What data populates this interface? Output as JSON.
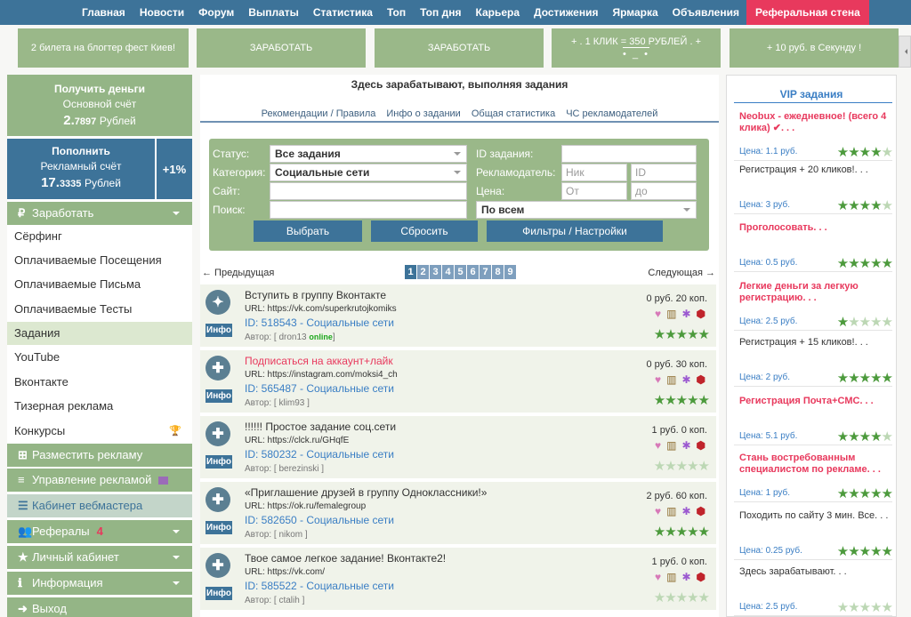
{
  "topnav": {
    "items": [
      "Главная",
      "Новости",
      "Форум",
      "Выплаты",
      "Статистика",
      "Топ",
      "Топ дня",
      "Карьера",
      "Достижения",
      "Ярмарка",
      "Объявления"
    ],
    "highlight": "Реферальная стена"
  },
  "banners": [
    {
      "line1": "2 билета на блогтер фест Киев!",
      "line2": ""
    },
    {
      "line1": "ЗАРАБОТАТЬ",
      "line2": ""
    },
    {
      "line1": "ЗАРАБОТАТЬ",
      "line2": ""
    },
    {
      "line1": "+ . 1 КЛИК = 350 РУБЛЕЙ . +",
      "line2": "• _ •"
    },
    {
      "line1": "+ 10 руб. в Секунду !",
      "line2": ""
    }
  ],
  "balance_main": {
    "title": "Получить деньги",
    "subtitle": "Основной счёт",
    "amount_int": "2.",
    "amount_frac": "7897",
    "currency": "Рублей"
  },
  "balance_ads": {
    "title": "Пополнить",
    "subtitle": "Рекламный счёт",
    "amount_int": "17.",
    "amount_frac": "3335",
    "currency": "Рублей",
    "bonus": "+1%"
  },
  "menu": {
    "earn": "Заработать",
    "earn_items": [
      "Сёрфинг",
      "Оплачиваемые Посещения",
      "Оплачиваемые Письма",
      "Оплачиваемые Тесты",
      "Задания",
      "YouTube",
      "Вконтакте",
      "Тизерная реклама",
      "Конкурсы"
    ],
    "place_ad": "Разместить рекламу",
    "manage_ads": "Управление рекламой",
    "webmaster": "Кабинет вебмастера",
    "referrals": "Рефералы",
    "referrals_count": "4",
    "cabinet": "Личный кабинет",
    "info": "Информация",
    "exit": "Выход"
  },
  "main": {
    "title": "Здесь зарабатывают, выполняя задания",
    "tabs": [
      "Рекомендации / Правила",
      "Инфо о задании",
      "Общая статистика",
      "ЧС рекламодателей"
    ]
  },
  "filter": {
    "status_label": "Статус:",
    "status_value": "Все задания",
    "category_label": "Категория:",
    "category_value": "Социальные сети",
    "site_label": "Сайт:",
    "search_label": "Поиск:",
    "id_label": "ID задания:",
    "advertiser_label": "Рекламодатель:",
    "advertiser_nick_ph": "Ник",
    "advertiser_id_ph": "ID",
    "price_label": "Цена:",
    "price_from_ph": "От",
    "price_to_ph": "до",
    "scope_value": "По всем",
    "btn_select": "Выбрать",
    "btn_reset": "Сбросить",
    "btn_filters": "Фильтры / Настройки"
  },
  "pager": {
    "prev": "← Предыдущая",
    "next": "Следующая →",
    "pages": [
      "1",
      "2",
      "3",
      "4",
      "5",
      "6",
      "7",
      "8",
      "9"
    ],
    "current": "1"
  },
  "tasks": [
    {
      "title": "Вступить в группу Вконтакте",
      "url": "URL: https://vk.com/superkrutojkomiks",
      "id": "ID: 518543 - Социальные сети",
      "author": "Автор: [ dron13",
      "online": "online",
      "author_end": "]",
      "price": "0 руб. 20 коп.",
      "stars": 5,
      "red": false,
      "icon": "✦"
    },
    {
      "title": "Подписаться на аккаунт+лайк",
      "url": "URL: https://instagram.com/moksi4_ch",
      "id": "ID: 565487 - Социальные сети",
      "author": "Автор: [ klim93 ]",
      "online": "",
      "author_end": "",
      "price": "0 руб. 30 коп.",
      "stars": 5,
      "red": true,
      "icon": "✚"
    },
    {
      "title": "!!!!!! Простое задание соц.сети",
      "url": "URL: https://clck.ru/GHqfE",
      "id": "ID: 580232 - Социальные сети",
      "author": "Автор: [ berezinski ]",
      "online": "",
      "author_end": "",
      "price": "1 руб. 0 коп.",
      "stars": 0,
      "red": false,
      "icon": "✚"
    },
    {
      "title": "«Приглашение друзей в группу Одноклассники!»",
      "url": "URL: https://ok.ru/femalegroup",
      "id": "ID: 582650 - Социальные сети",
      "author": "Автор: [ nikom ]",
      "online": "",
      "author_end": "",
      "price": "2 руб. 60 коп.",
      "stars": 5,
      "red": false,
      "icon": "✚"
    },
    {
      "title": "Твое самое легкое задание! Вконтакте2!",
      "url": "URL: https://vk.com/",
      "id": "ID: 585522 - Социальные сети",
      "author": "Автор: [ ctalih ]",
      "online": "",
      "author_end": "",
      "price": "1 руб. 0 коп.",
      "stars": 0,
      "red": false,
      "icon": "✚"
    }
  ],
  "task_info_label": "Инфо",
  "vip": {
    "title": "VIP задания",
    "items": [
      {
        "text": "Neobux - ежедневное! (всего 4 клика) ✔. . .",
        "price": "Цена: 1.1 руб.",
        "stars": 4,
        "red": true
      },
      {
        "text": "Регистрация + 20 кликов!. . .",
        "price": "Цена: 3 руб.",
        "stars": 4,
        "red": false
      },
      {
        "text": "Проголосовать. . .",
        "price": "Цена: 0.5 руб.",
        "stars": 5,
        "red": true
      },
      {
        "text": "Легкие деньги за легкую регистрацию. . .",
        "price": "Цена: 2.5 руб.",
        "stars": 1,
        "red": true
      },
      {
        "text": "Регистрация + 15 кликов!. . .",
        "price": "Цена: 2 руб.",
        "stars": 5,
        "red": false
      },
      {
        "text": "Регистрация Почта+СМС. . .",
        "price": "Цена: 5.1 руб.",
        "stars": 4,
        "red": true
      },
      {
        "text": "Стань востребованным специалистом по рекламе. . .",
        "price": "Цена: 1 руб.",
        "stars": 5,
        "red": true
      },
      {
        "text": "Походить по сайту 3 мин. Все. . .",
        "price": "Цена: 0.25 руб.",
        "stars": 5,
        "red": false
      },
      {
        "text": "Здесь зарабатывают. . .",
        "price": "Цена: 2.5 руб.",
        "stars": 0,
        "red": false
      }
    ]
  }
}
